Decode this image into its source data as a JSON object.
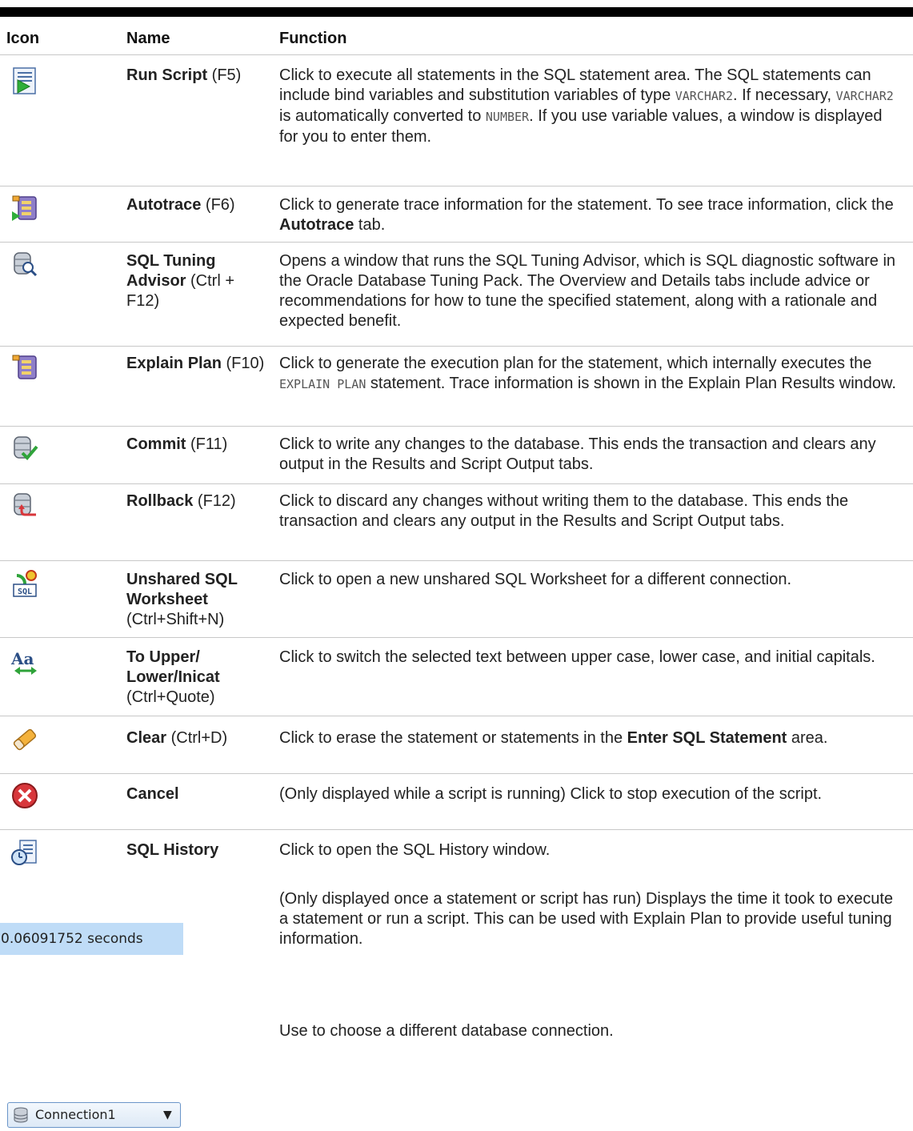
{
  "header": {
    "icon": "Icon",
    "name": "Name",
    "function": "Function"
  },
  "rows": [
    {
      "icon": "run-script-icon",
      "name": "Run Script",
      "shortcut": " (F5)",
      "desc": [
        "Click to execute all statements in the SQL statement area. The SQL statements can include bind variables and substitution variables of type ",
        "VARCHAR2",
        ". If necessary, ",
        "VARCHAR2",
        " is automatically converted to ",
        "NUMBER",
        ". If you use variable values, a window is displayed for you to enter them."
      ]
    },
    {
      "icon": "autotrace-icon",
      "name": "Autotrace",
      "shortcut": " (F6)",
      "desc": [
        "Click to generate trace information for the statement. To see trace information, click the ",
        "Autotrace",
        " tab."
      ]
    },
    {
      "icon": "sql-tuning-advisor-icon",
      "name": "SQL Tuning Advisor",
      "shortcut": " (Ctrl + F12)",
      "desc": "Opens a window that runs the SQL Tuning Advisor, which is SQL diagnostic software in the Oracle Database Tuning Pack. The Overview and Details tabs include advice or recommendations for how to tune the specified statement, along with a rationale and expected benefit."
    },
    {
      "icon": "explain-plan-icon",
      "name": "Explain Plan",
      "shortcut": " (F10)",
      "desc": [
        "Click to generate the execution plan for the statement, which internally executes the ",
        "EXPLAIN PLAN",
        " statement. Trace information is shown in the Explain Plan Results window."
      ]
    },
    {
      "icon": "commit-icon",
      "name": "Commit",
      "shortcut": " (F11)",
      "desc": "Click to write any changes to the database. This ends the transaction and clears any output in the Results and Script Output tabs."
    },
    {
      "icon": "rollback-icon",
      "name": "Rollback",
      "shortcut": " (F12)",
      "desc": "Click to discard any changes without writing them to the database. This ends the transaction and clears any output in the Results and Script Output tabs."
    },
    {
      "icon": "unshared-sql-worksheet-icon",
      "name": "Unshared SQL Worksheet",
      "shortcut": "(Ctrl+Shift+N)",
      "desc": "Click to open a new unshared SQL Worksheet for a different connection."
    },
    {
      "icon": "change-case-icon",
      "name": "To Upper/ Lower/Inicat",
      "shortcut": "(Ctrl+Quote)",
      "desc": "Click to switch the selected text between upper case, lower case, and initial capitals."
    },
    {
      "icon": "eraser-icon",
      "name": "Clear",
      "shortcut": " (Ctrl+D)",
      "desc": [
        "Click to erase the statement or statements in the ",
        "Enter SQL Statement",
        " area."
      ]
    },
    {
      "icon": "cancel-icon",
      "name": "Cancel",
      "shortcut": "",
      "desc": "(Only displayed while a script is running) Click to stop execution of the script."
    },
    {
      "icon": "sql-history-icon",
      "name": "SQL History",
      "shortcut": "",
      "desc": "Click to open the SQL History window."
    },
    {
      "icon": "timer-display",
      "name": "",
      "shortcut": "",
      "desc": "(Only displayed once a statement or script has run) Displays the time it took to execute a statement or run a script. This can be used with Explain Plan to provide useful tuning information."
    },
    {
      "icon": "connection-selector",
      "name": "",
      "shortcut": "",
      "desc": "Use to choose a different database connection."
    }
  ],
  "timer": {
    "text": "0.06091752 seconds"
  },
  "connection": {
    "label": "Connection1"
  }
}
